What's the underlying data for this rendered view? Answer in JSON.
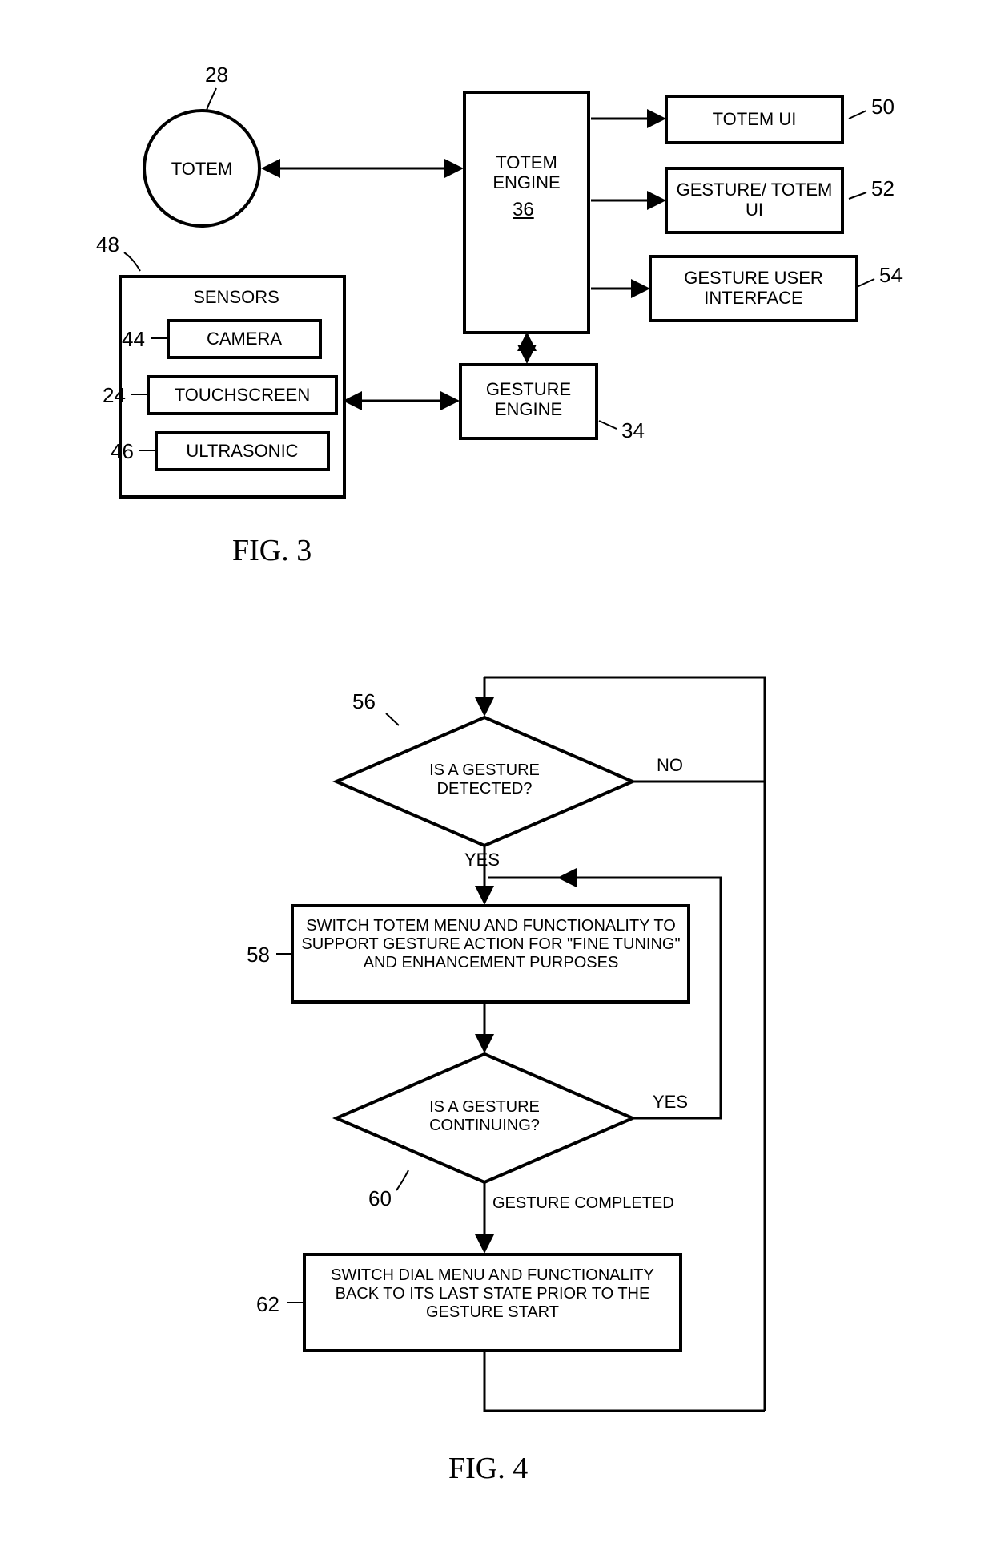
{
  "fig3": {
    "title": "FIG. 3",
    "totem": {
      "label": "TOTEM",
      "ref": "28"
    },
    "sensors": {
      "title": "SENSORS",
      "ref": "48",
      "camera": {
        "label": "CAMERA",
        "ref": "44"
      },
      "touchscreen": {
        "label": "TOUCHSCREEN",
        "ref": "24"
      },
      "ultrasonic": {
        "label": "ULTRASONIC",
        "ref": "46"
      }
    },
    "totem_engine": {
      "label": "TOTEM ENGINE",
      "ref": "36"
    },
    "gesture_engine": {
      "label": "GESTURE ENGINE",
      "ref": "34"
    },
    "totem_ui": {
      "label": "TOTEM UI",
      "ref": "50"
    },
    "gesture_totem_ui": {
      "label": "GESTURE/ TOTEM UI",
      "ref": "52"
    },
    "gesture_user_interface": {
      "label": "GESTURE USER INTERFACE",
      "ref": "54"
    }
  },
  "fig4": {
    "title": "FIG. 4",
    "d1": {
      "label": "IS A GESTURE DETECTED?",
      "ref": "56",
      "yes": "YES",
      "no": "NO"
    },
    "p1": {
      "label": "SWITCH TOTEM MENU AND FUNCTIONALITY TO SUPPORT GESTURE ACTION FOR \"FINE TUNING\" AND ENHANCEMENT PURPOSES",
      "ref": "58"
    },
    "d2": {
      "label": "IS A GESTURE CONTINUING?",
      "ref": "60",
      "yes": "YES",
      "done": "GESTURE COMPLETED"
    },
    "p2": {
      "label": "SWITCH DIAL MENU AND FUNCTIONALITY BACK TO ITS LAST STATE PRIOR TO THE GESTURE START",
      "ref": "62"
    }
  }
}
